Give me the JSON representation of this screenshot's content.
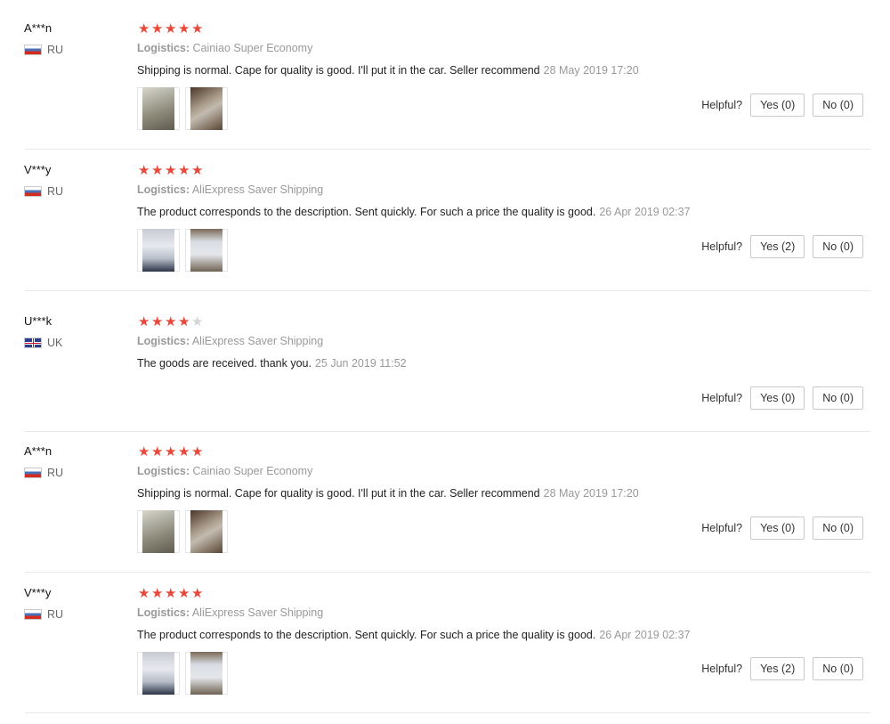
{
  "helpful_label": "Helpful?",
  "reviews": [
    {
      "user": "A***n",
      "country": "RU",
      "rating": 5,
      "logistics_label": "Logistics:",
      "logistics": "Cainiao Super Economy",
      "text": "Shipping is normal. Cape for quality is good. I'll put it in the car. Seller recommend",
      "date": "28 May 2019 17:20",
      "yes": "Yes (0)",
      "no": "No (0)"
    },
    {
      "user": "V***y",
      "country": "RU",
      "rating": 5,
      "logistics_label": "Logistics:",
      "logistics": "AliExpress Saver Shipping",
      "text": "The product corresponds to the description. Sent quickly. For such a price the quality is good.",
      "date": "26 Apr 2019 02:37",
      "yes": "Yes (2)",
      "no": "No (0)"
    },
    {
      "user": "U***k",
      "country": "UK",
      "rating": 4,
      "logistics_label": "Logistics:",
      "logistics": "AliExpress Saver Shipping",
      "text": "The goods are received. thank you.",
      "date": "25 Jun 2019 11:52",
      "yes": "Yes (0)",
      "no": "No (0)"
    },
    {
      "user": "A***n",
      "country": "RU",
      "rating": 5,
      "logistics_label": "Logistics:",
      "logistics": "Cainiao Super Economy",
      "text": "Shipping is normal. Cape for quality is good. I'll put it in the car. Seller recommend",
      "date": "28 May 2019 17:20",
      "yes": "Yes (0)",
      "no": "No (0)"
    },
    {
      "user": "V***y",
      "country": "RU",
      "rating": 5,
      "logistics_label": "Logistics:",
      "logistics": "AliExpress Saver Shipping",
      "text": "The product corresponds to the description. Sent quickly. For such a price the quality is good.",
      "date": "26 Apr 2019 02:37",
      "yes": "Yes (2)",
      "no": "No (0)"
    }
  ]
}
